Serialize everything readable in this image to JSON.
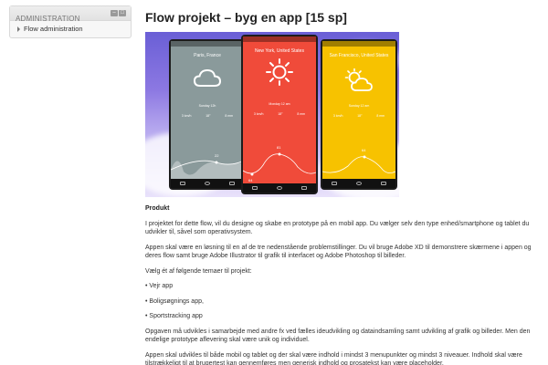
{
  "sidebar": {
    "title": "ADMINISTRATION",
    "item": "Flow administration"
  },
  "main": {
    "title": "Flow projekt – byg en app [15 sp]",
    "heading": "Produkt",
    "paragraphs": [
      "I projektet for dette flow, vil du designe og skabe en prototype på en mobil app. Du vælger selv den type enhed/smartphone og tablet du udvikler til, såvel som operativsystem.",
      "Appen skal være en løsning til en af de tre nedenstående problemstillinger. Du vil bruge Adobe XD til demonstrere skærmene i appen og deres flow samt bruge Adobe Illustrator til grafik til interfacet og Adobe Photoshop til billeder.",
      "Vælg ét af følgende temaer til projekt:"
    ],
    "bullets": [
      "• Vejr app",
      "• Boligsøgnings app,",
      "• Sportstracking app"
    ],
    "paragraphs2": [
      "Opgaven må udvikles i samarbejde med andre fx ved fælles ideudvikling og dataindsamling samt udvikling af grafik og billeder. Men den endelige prototype aflevering skal være unik og individuel.",
      "Appen skal udvikles til både mobil og tablet og der skal være indhold i mindst 3 menupunkter og mindst 3 niveauer. Indhold skal være tilstrækkeligt til at brugertest kan gennemføres men generisk indhold og prosatekst kan være placeholder."
    ]
  },
  "hero": {
    "phones": [
      {
        "city": "Paris, France",
        "date": "Sunday 12h",
        "color": "#8a9a9b",
        "icon": "cloud-icon",
        "stats": [
          "3 km/h",
          "18°",
          "8 mm"
        ],
        "peak": "22",
        "low": ""
      },
      {
        "city": "New York, United States",
        "date": "Monday 12 am",
        "color": "#f04b3a",
        "icon": "sun-icon",
        "stats": [
          "3 km/h",
          "18°",
          "8 mm"
        ],
        "peak": "81",
        "low": "64"
      },
      {
        "city": "San Francisco, United States",
        "date": "Sunday 12 am",
        "color": "#f7c200",
        "icon": "partly-cloudy-icon",
        "stats": [
          "3 km/h",
          "18°",
          "8 mm"
        ],
        "peak": "64",
        "low": ""
      }
    ]
  }
}
